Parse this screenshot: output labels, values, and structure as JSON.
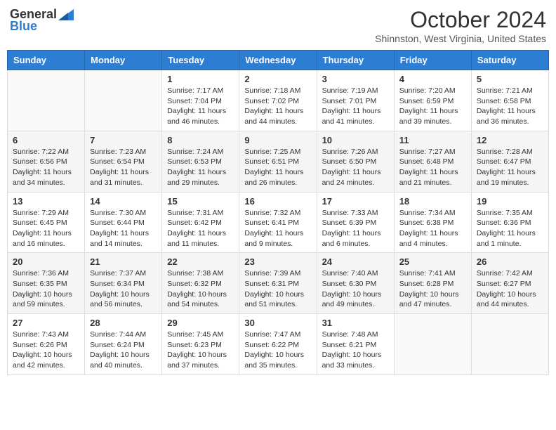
{
  "logo": {
    "general": "General",
    "blue": "Blue"
  },
  "title": "October 2024",
  "location": "Shinnston, West Virginia, United States",
  "days_of_week": [
    "Sunday",
    "Monday",
    "Tuesday",
    "Wednesday",
    "Thursday",
    "Friday",
    "Saturday"
  ],
  "weeks": [
    [
      {
        "day": "",
        "content": ""
      },
      {
        "day": "",
        "content": ""
      },
      {
        "day": "1",
        "content": "Sunrise: 7:17 AM\nSunset: 7:04 PM\nDaylight: 11 hours and 46 minutes."
      },
      {
        "day": "2",
        "content": "Sunrise: 7:18 AM\nSunset: 7:02 PM\nDaylight: 11 hours and 44 minutes."
      },
      {
        "day": "3",
        "content": "Sunrise: 7:19 AM\nSunset: 7:01 PM\nDaylight: 11 hours and 41 minutes."
      },
      {
        "day": "4",
        "content": "Sunrise: 7:20 AM\nSunset: 6:59 PM\nDaylight: 11 hours and 39 minutes."
      },
      {
        "day": "5",
        "content": "Sunrise: 7:21 AM\nSunset: 6:58 PM\nDaylight: 11 hours and 36 minutes."
      }
    ],
    [
      {
        "day": "6",
        "content": "Sunrise: 7:22 AM\nSunset: 6:56 PM\nDaylight: 11 hours and 34 minutes."
      },
      {
        "day": "7",
        "content": "Sunrise: 7:23 AM\nSunset: 6:54 PM\nDaylight: 11 hours and 31 minutes."
      },
      {
        "day": "8",
        "content": "Sunrise: 7:24 AM\nSunset: 6:53 PM\nDaylight: 11 hours and 29 minutes."
      },
      {
        "day": "9",
        "content": "Sunrise: 7:25 AM\nSunset: 6:51 PM\nDaylight: 11 hours and 26 minutes."
      },
      {
        "day": "10",
        "content": "Sunrise: 7:26 AM\nSunset: 6:50 PM\nDaylight: 11 hours and 24 minutes."
      },
      {
        "day": "11",
        "content": "Sunrise: 7:27 AM\nSunset: 6:48 PM\nDaylight: 11 hours and 21 minutes."
      },
      {
        "day": "12",
        "content": "Sunrise: 7:28 AM\nSunset: 6:47 PM\nDaylight: 11 hours and 19 minutes."
      }
    ],
    [
      {
        "day": "13",
        "content": "Sunrise: 7:29 AM\nSunset: 6:45 PM\nDaylight: 11 hours and 16 minutes."
      },
      {
        "day": "14",
        "content": "Sunrise: 7:30 AM\nSunset: 6:44 PM\nDaylight: 11 hours and 14 minutes."
      },
      {
        "day": "15",
        "content": "Sunrise: 7:31 AM\nSunset: 6:42 PM\nDaylight: 11 hours and 11 minutes."
      },
      {
        "day": "16",
        "content": "Sunrise: 7:32 AM\nSunset: 6:41 PM\nDaylight: 11 hours and 9 minutes."
      },
      {
        "day": "17",
        "content": "Sunrise: 7:33 AM\nSunset: 6:39 PM\nDaylight: 11 hours and 6 minutes."
      },
      {
        "day": "18",
        "content": "Sunrise: 7:34 AM\nSunset: 6:38 PM\nDaylight: 11 hours and 4 minutes."
      },
      {
        "day": "19",
        "content": "Sunrise: 7:35 AM\nSunset: 6:36 PM\nDaylight: 11 hours and 1 minute."
      }
    ],
    [
      {
        "day": "20",
        "content": "Sunrise: 7:36 AM\nSunset: 6:35 PM\nDaylight: 10 hours and 59 minutes."
      },
      {
        "day": "21",
        "content": "Sunrise: 7:37 AM\nSunset: 6:34 PM\nDaylight: 10 hours and 56 minutes."
      },
      {
        "day": "22",
        "content": "Sunrise: 7:38 AM\nSunset: 6:32 PM\nDaylight: 10 hours and 54 minutes."
      },
      {
        "day": "23",
        "content": "Sunrise: 7:39 AM\nSunset: 6:31 PM\nDaylight: 10 hours and 51 minutes."
      },
      {
        "day": "24",
        "content": "Sunrise: 7:40 AM\nSunset: 6:30 PM\nDaylight: 10 hours and 49 minutes."
      },
      {
        "day": "25",
        "content": "Sunrise: 7:41 AM\nSunset: 6:28 PM\nDaylight: 10 hours and 47 minutes."
      },
      {
        "day": "26",
        "content": "Sunrise: 7:42 AM\nSunset: 6:27 PM\nDaylight: 10 hours and 44 minutes."
      }
    ],
    [
      {
        "day": "27",
        "content": "Sunrise: 7:43 AM\nSunset: 6:26 PM\nDaylight: 10 hours and 42 minutes."
      },
      {
        "day": "28",
        "content": "Sunrise: 7:44 AM\nSunset: 6:24 PM\nDaylight: 10 hours and 40 minutes."
      },
      {
        "day": "29",
        "content": "Sunrise: 7:45 AM\nSunset: 6:23 PM\nDaylight: 10 hours and 37 minutes."
      },
      {
        "day": "30",
        "content": "Sunrise: 7:47 AM\nSunset: 6:22 PM\nDaylight: 10 hours and 35 minutes."
      },
      {
        "day": "31",
        "content": "Sunrise: 7:48 AM\nSunset: 6:21 PM\nDaylight: 10 hours and 33 minutes."
      },
      {
        "day": "",
        "content": ""
      },
      {
        "day": "",
        "content": ""
      }
    ]
  ]
}
